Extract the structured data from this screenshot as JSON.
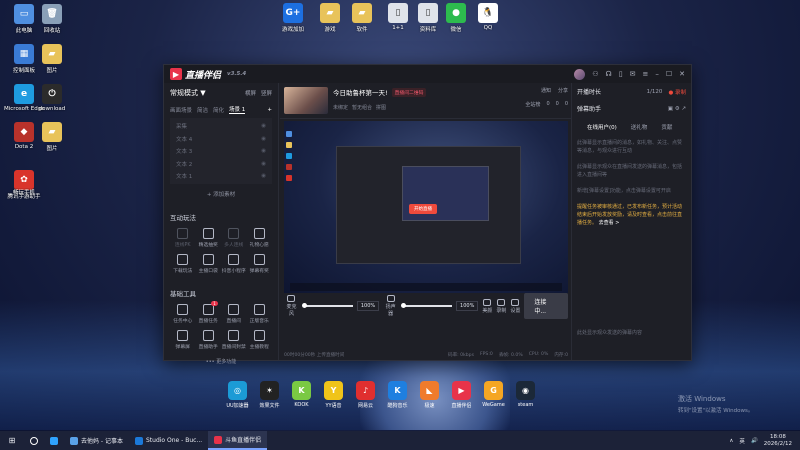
{
  "desktop": {
    "left_icons": [
      {
        "label": "此电脑",
        "color": "#4f8fe0",
        "glyph": "▭"
      },
      {
        "label": "回收站",
        "color": "#8aa0b8",
        "glyph": "🗑"
      },
      {
        "label": "控制面板",
        "color": "#3a7bd5",
        "glyph": "▦"
      },
      {
        "label": "图片",
        "color": "#e8c35a",
        "glyph": "▰"
      },
      {
        "label": "Microsoft Edge",
        "color": "#1e9be0",
        "glyph": "e"
      },
      {
        "label": "download",
        "color": "#2b2b2b",
        "glyph": "⏻"
      },
      {
        "label": "Dota 2",
        "color": "#b8322b",
        "glyph": "◆"
      },
      {
        "label": "图片",
        "color": "#e8c35a",
        "glyph": "▰"
      },
      {
        "label": "腾讯手游助手",
        "color": "#d9342b",
        "glyph": "✿"
      },
      {
        "label": "畅玩手机",
        "color": "#d9342b",
        "glyph": ""
      }
    ],
    "top_icons": [
      {
        "label": "游戏加加",
        "color": "#1d6fe0",
        "glyph": "G+"
      },
      {
        "label": "游戏",
        "color": "#e8c35a",
        "glyph": "▰"
      },
      {
        "label": "软件",
        "color": "#e8c35a",
        "glyph": "▰"
      },
      {
        "label": "1+1",
        "color": "#dfe3ea",
        "glyph": "▯"
      },
      {
        "label": "资料库",
        "color": "#dfe3ea",
        "glyph": "▯"
      },
      {
        "label": "微信",
        "color": "#2dbb4e",
        "glyph": "●"
      },
      {
        "label": "QQ",
        "color": "#ffffff",
        "glyph": "🐧"
      }
    ]
  },
  "app": {
    "name": "直播伴侣",
    "version": "v3.5.4",
    "titlebar_icons": [
      "shirt-icon",
      "headset-icon",
      "mobile-icon",
      "mail-icon",
      "menu-icon"
    ]
  },
  "left_panel": {
    "mode": "常规模式 ▼",
    "mode_options": [
      "横屏",
      "竖屏"
    ],
    "scene_tabs": [
      "画面场景",
      "简洁",
      "简化",
      "场景 1"
    ],
    "sources": [
      "采集",
      "文本 4",
      "文本 3",
      "文本 2",
      "文本 1"
    ],
    "add_source": "+ 添加素材",
    "interactive_title": "互动玩法",
    "interactive_tools": [
      {
        "label": "连线PK",
        "dim": true,
        "icon": "link-icon"
      },
      {
        "label": "精选抽奖",
        "dim": false,
        "icon": "shield-icon"
      },
      {
        "label": "多人连线",
        "dim": true,
        "icon": "people-icon"
      },
      {
        "label": "礼物心愿",
        "dim": false,
        "icon": "gift-icon"
      },
      {
        "label": "下载玩法",
        "dim": false,
        "icon": "download-icon"
      },
      {
        "label": "主播口袋",
        "dim": false,
        "icon": "pocket-icon"
      },
      {
        "label": "抖音小程序",
        "dim": false,
        "icon": "diamond-icon"
      },
      {
        "label": "弹幕有奖",
        "dim": false,
        "icon": "bubble-icon"
      }
    ],
    "basic_title": "基础工具",
    "basic_tools": [
      {
        "label": "任务中心",
        "badge": "",
        "icon": "task-icon"
      },
      {
        "label": "直播任务",
        "badge": "1",
        "icon": "image-icon"
      },
      {
        "label": "直播间",
        "badge": "",
        "icon": "doc-icon"
      },
      {
        "label": "正版音乐",
        "badge": "",
        "icon": "music-icon"
      },
      {
        "label": "弹幕屏",
        "badge": "",
        "icon": "screen-icon"
      },
      {
        "label": "直播助手",
        "badge": "",
        "icon": "mic-icon"
      },
      {
        "label": "直播间封禁",
        "badge": "",
        "icon": "ban-icon"
      },
      {
        "label": "主播教程",
        "badge": "",
        "icon": "book-icon"
      }
    ],
    "more": "••• 更多功能"
  },
  "center": {
    "stream_title": "今日助鲁杯第一天!",
    "tag": "直播间二维码",
    "sub_info": [
      "未绑定",
      "暂无组合",
      "拼图"
    ],
    "right_top": [
      "通知",
      "分享"
    ],
    "right_stats": [
      "全站榜",
      "0",
      "0",
      "0"
    ],
    "preview_button": "开始直播",
    "audio": {
      "mic_label": "麦克风",
      "mic_pct": "100%",
      "speaker_label": "扬声器",
      "speaker_pct": "100%"
    },
    "controls": [
      "美颜",
      "录制",
      "设置"
    ],
    "live_button": "连接中...",
    "status": [
      "00时00分00秒 上传直播时间",
      "码率: 0kbps",
      "FPS:0",
      "丢帧: 0.0%",
      "CPU: 0%",
      "内存:0"
    ]
  },
  "right_panel": {
    "title": "开播时长",
    "count": "1/120",
    "record": "● 录制",
    "assistant": "弹幕助手",
    "tabs": [
      "在线用户(0)",
      "送礼物",
      "贡献"
    ],
    "messages": [
      "此弹幕显示直播间的消息，如礼物、关注、点赞等消息，与观众进行互动",
      "此弹幕显示观众在直播间发送的弹幕消息，包括进入直播间等",
      "新增[弹幕设置]功能，点击弹幕设置可开启"
    ],
    "highlight": "提醒任务被审核通过，已发布新任务，预计活动结束后开始发放奖励，请及时查看，点击前往直播任务。",
    "highlight_link": "去查看 >",
    "input_hint": "此处显示观众发送的弹幕内容"
  },
  "dock": [
    {
      "label": "UU加速器",
      "color": "#1b9bd6",
      "glyph": "◎"
    },
    {
      "label": "效果文件",
      "color": "#222222",
      "glyph": "✶"
    },
    {
      "label": "KOOK",
      "color": "#7ac943",
      "glyph": "K"
    },
    {
      "label": "YY语音",
      "color": "#f0c419",
      "glyph": "Y"
    },
    {
      "label": "网易云",
      "color": "#e02f2f",
      "glyph": "♪"
    },
    {
      "label": "酷狗音乐",
      "color": "#1e7fe0",
      "glyph": "K"
    },
    {
      "label": "极速",
      "color": "#f07b2b",
      "glyph": "◣"
    },
    {
      "label": "直播伴侣",
      "color": "#e8334a",
      "glyph": "▶"
    },
    {
      "label": "WeGame",
      "color": "#f5a623",
      "glyph": "G"
    },
    {
      "label": "steam",
      "color": "#1b2838",
      "glyph": "◉"
    }
  ],
  "watermark": {
    "line1": "激活 Windows",
    "line2": "转到\"设置\"以激活 Windows。"
  },
  "taskbar": {
    "start": "⊞",
    "items": [
      {
        "label": "",
        "icon_color": "#ffffff",
        "active": false
      },
      {
        "label": "",
        "icon_color": "#2fa3ff",
        "active": false
      },
      {
        "label": "去他妈 - 记事本",
        "icon_color": "#5aa2e8",
        "active": false
      },
      {
        "label": "Studio One - Buc...",
        "icon_color": "#1b79d9",
        "active": false
      },
      {
        "label": "斗鱼直播伴侣",
        "icon_color": "#e8334a",
        "active": true
      }
    ],
    "tray": [
      "∧",
      "英",
      "🔊"
    ],
    "time": "18:08",
    "date": "2026/2/12"
  }
}
